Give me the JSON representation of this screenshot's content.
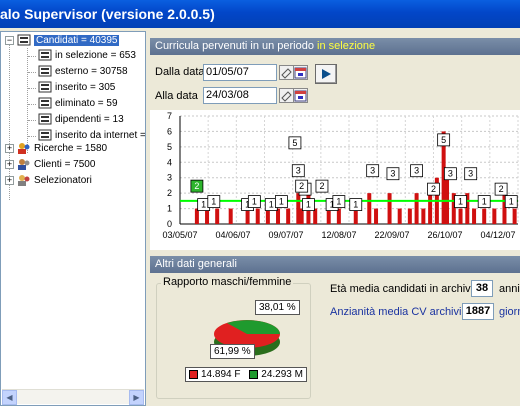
{
  "window": {
    "title": "alo Supervisor (versione 2.0.0.5)"
  },
  "tree": {
    "root": {
      "label": "Candidati = 40395"
    },
    "children": [
      {
        "label": "in selezione = 653"
      },
      {
        "label": "esterno = 30758"
      },
      {
        "label": "inserito = 305"
      },
      {
        "label": "eliminato = 59"
      },
      {
        "label": "dipendenti = 13"
      },
      {
        "label": "inserito da internet ="
      }
    ],
    "others": [
      {
        "label": "Ricerche = 1580"
      },
      {
        "label": "Clienti = 7500"
      },
      {
        "label": "Selezionatori"
      }
    ],
    "expand_plus": "+",
    "expand_minus": "−"
  },
  "period_panel": {
    "heading": "Curricula pervenuti in un periodo",
    "heading_highlight": "in selezione",
    "from_label": "Dalla data",
    "from_value": "01/05/07",
    "to_label": "Alla data",
    "to_value": "24/03/08"
  },
  "chart_data": {
    "type": "bar",
    "ylim": [
      0,
      7
    ],
    "y_ticks": [
      "0",
      "1",
      "2",
      "3",
      "4",
      "5",
      "6",
      "7"
    ],
    "x_ticks": [
      "03/05/07",
      "04/06/07",
      "09/07/07",
      "12/08/07",
      "22/09/07",
      "26/10/07",
      "04/12/07"
    ],
    "reference_line": 1.5,
    "point_labels": [
      {
        "pos": 0.05,
        "value": 2
      },
      {
        "pos": 0.07,
        "value": 1
      },
      {
        "pos": 0.1,
        "value": 1
      },
      {
        "pos": 0.2,
        "value": 1
      },
      {
        "pos": 0.22,
        "value": 1
      },
      {
        "pos": 0.27,
        "value": 1
      },
      {
        "pos": 0.3,
        "value": 1
      },
      {
        "pos": 0.34,
        "value": 5
      },
      {
        "pos": 0.35,
        "value": 3
      },
      {
        "pos": 0.37,
        "value": 2
      },
      {
        "pos": 0.36,
        "value": 2
      },
      {
        "pos": 0.38,
        "value": 1
      },
      {
        "pos": 0.42,
        "value": 2
      },
      {
        "pos": 0.45,
        "value": 1
      },
      {
        "pos": 0.47,
        "value": 1
      },
      {
        "pos": 0.52,
        "value": 1
      },
      {
        "pos": 0.57,
        "value": 3
      },
      {
        "pos": 0.63,
        "value": 3
      },
      {
        "pos": 0.7,
        "value": 3
      },
      {
        "pos": 0.75,
        "value": 2
      },
      {
        "pos": 0.78,
        "value": 5
      },
      {
        "pos": 0.8,
        "value": 3
      },
      {
        "pos": 0.83,
        "value": 1
      },
      {
        "pos": 0.86,
        "value": 3
      },
      {
        "pos": 0.9,
        "value": 1
      },
      {
        "pos": 0.95,
        "value": 2
      },
      {
        "pos": 0.98,
        "value": 1
      }
    ],
    "bars": [
      {
        "pos": 0.05,
        "value": 1
      },
      {
        "pos": 0.08,
        "value": 1
      },
      {
        "pos": 0.11,
        "value": 1
      },
      {
        "pos": 0.15,
        "value": 1
      },
      {
        "pos": 0.2,
        "value": 1
      },
      {
        "pos": 0.23,
        "value": 1
      },
      {
        "pos": 0.26,
        "value": 1
      },
      {
        "pos": 0.29,
        "value": 1
      },
      {
        "pos": 0.32,
        "value": 1
      },
      {
        "pos": 0.35,
        "value": 2
      },
      {
        "pos": 0.36,
        "value": 1
      },
      {
        "pos": 0.38,
        "value": 2
      },
      {
        "pos": 0.4,
        "value": 1
      },
      {
        "pos": 0.44,
        "value": 1
      },
      {
        "pos": 0.47,
        "value": 1
      },
      {
        "pos": 0.52,
        "value": 1
      },
      {
        "pos": 0.56,
        "value": 2
      },
      {
        "pos": 0.58,
        "value": 1
      },
      {
        "pos": 0.62,
        "value": 2
      },
      {
        "pos": 0.65,
        "value": 1
      },
      {
        "pos": 0.68,
        "value": 1
      },
      {
        "pos": 0.7,
        "value": 2
      },
      {
        "pos": 0.72,
        "value": 1
      },
      {
        "pos": 0.74,
        "value": 2
      },
      {
        "pos": 0.76,
        "value": 3
      },
      {
        "pos": 0.78,
        "value": 6
      },
      {
        "pos": 0.79,
        "value": 3
      },
      {
        "pos": 0.81,
        "value": 2
      },
      {
        "pos": 0.83,
        "value": 1
      },
      {
        "pos": 0.85,
        "value": 2
      },
      {
        "pos": 0.87,
        "value": 1
      },
      {
        "pos": 0.9,
        "value": 1
      },
      {
        "pos": 0.93,
        "value": 1
      },
      {
        "pos": 0.96,
        "value": 2
      },
      {
        "pos": 0.99,
        "value": 1
      }
    ]
  },
  "other_data": {
    "heading": "Altri dati generali",
    "gender_group_title": "Rapporto maschi/femmine",
    "female_pct": "61,99 %",
    "male_pct": "38,01 %",
    "female_count": "14.894 F",
    "male_count": "24.293 M",
    "avg_age_label": "Età media candidati in archivio:",
    "avg_age_value": "38",
    "avg_age_unit": "anni",
    "cv_age_label": "Anzianità media CV archiviati:",
    "cv_age_value": "1887",
    "cv_age_unit": "giorni"
  },
  "colors": {
    "female": "#e02020",
    "male": "#1f9a2e",
    "link_text": "#1a33a0",
    "highlight": "#ffff40",
    "bars": "#d01010",
    "line": "#00ff00"
  },
  "icons": [
    "folder-icon",
    "document-icon",
    "people-icon",
    "calendar-icon",
    "eraser-icon",
    "play-icon"
  ]
}
